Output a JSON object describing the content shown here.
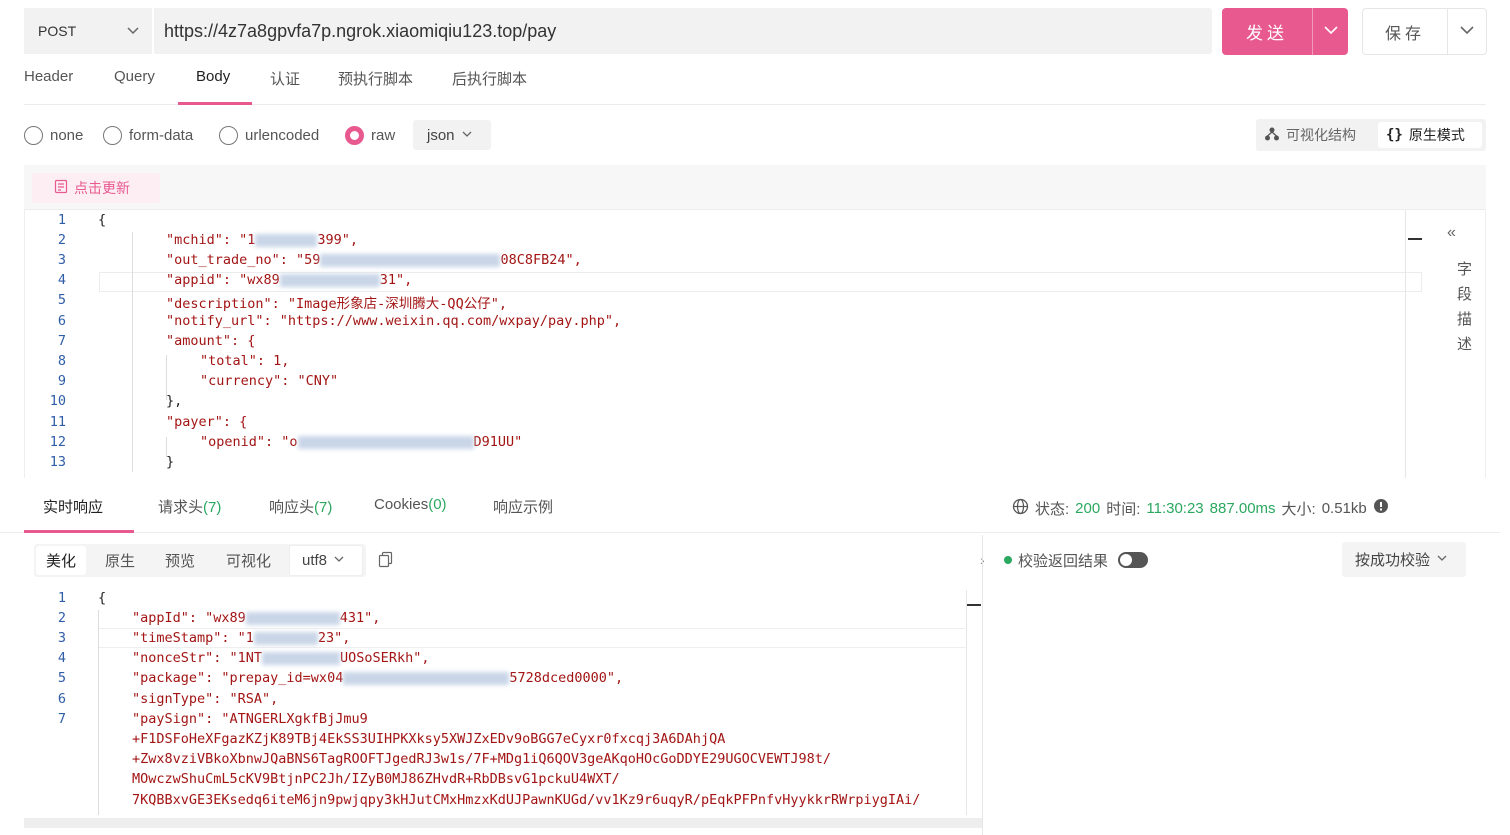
{
  "request": {
    "method": "POST",
    "url": "https://4z7a8gpvfa7p.ngrok.xiaomiqiu123.top/pay",
    "send_label": "发送",
    "save_label": "保存"
  },
  "request_tabs": [
    "Header",
    "Query",
    "Body",
    "认证",
    "预执行脚本",
    "后执行脚本"
  ],
  "active_request_tab": "Body",
  "body_types": [
    "none",
    "form-data",
    "urlencoded",
    "raw"
  ],
  "selected_body_type": "raw",
  "raw_format": "json",
  "view_modes": {
    "visual": "可视化结构",
    "raw": "原生模式"
  },
  "update_button": "点击更新",
  "side_panel": {
    "label": "字段描述"
  },
  "request_body": {
    "line_numbers": [
      "1",
      "2",
      "3",
      "4",
      "5",
      "6",
      "7",
      "8",
      "9",
      "10",
      "11",
      "12",
      "13"
    ],
    "lines": [
      "{",
      "\"mchid\": \"1",
      "399\",",
      "\"out_trade_no\": \"59",
      "08C8FB24\",",
      "\"appid\": \"wx89",
      "31\",",
      "\"description\": \"Image形象店-深圳腾大-QQ公仔\",",
      "\"notify_url\": \"https://www.weixin.qq.com/wxpay/pay.php\",",
      "\"amount\": {",
      "\"total\": 1,",
      "\"currency\": \"CNY\"",
      "},",
      "\"payer\": {",
      "\"openid\": \"o",
      "D91UU\"",
      "}"
    ]
  },
  "response_tabs": [
    {
      "label": "实时响应",
      "count": ""
    },
    {
      "label": "请求头",
      "count": "(7)"
    },
    {
      "label": "响应头",
      "count": "(7)"
    },
    {
      "label": "Cookies",
      "count": "(0)"
    },
    {
      "label": "响应示例",
      "count": ""
    }
  ],
  "status": {
    "status_label": "状态:",
    "status_value": "200",
    "time_label": "时间:",
    "time_value": "11:30:23",
    "duration": "887.00ms",
    "size_label": "大小:",
    "size_value": "0.51kb"
  },
  "response_toolbar": [
    "美化",
    "原生",
    "预览",
    "可视化"
  ],
  "encoding": "utf8",
  "verify": {
    "label": "校验返回结果",
    "mode": "按成功校验"
  },
  "response_body": {
    "line_numbers": [
      "1",
      "2",
      "3",
      "4",
      "5",
      "6",
      "7"
    ],
    "lines": [
      "{",
      "\"appId\": \"wx89",
      "431\",",
      "\"timeStamp\": \"1",
      "23\",",
      "\"nonceStr\": \"1NT",
      "UOSoSERkh\",",
      "\"package\": \"prepay_id=wx04",
      "5728dced0000\",",
      "\"signType\": \"RSA\",",
      "\"paySign\": \"ATNGERLXgkfBjJmu9",
      "+F1DSFoHeXFgazKZjK89TBj4EkSS3UIHPKXksy5XWJZxEDv9oBGG7eCyxr0fxcqj3A6DAhjQA",
      "+Zwx8vziVBkoXbnwJQaBNS6TagROOFTJgedRJ3w1s/7F+MDg1iQ6QOV3geAKqoHOcGoDDYE29UGOCVEWTJ98t/",
      "MOwczwShuCmL5cKV9BtjnPC2Jh/IZyB0MJ86ZHvdR+RbDBsvG1pckuU4WXT/",
      "7KQBBxvGE3EKsedq6iteM6jn9pwjqpy3kHJutCMxHmzxKdUJPawnKUGd/vv1Kz9r6uqyR/pEqkPFPnfvHyykkrRWrpiygIAi/"
    ]
  },
  "colors": {
    "accent": "#e8598f",
    "success": "#2ba860",
    "line_number": "#2f5da8"
  }
}
